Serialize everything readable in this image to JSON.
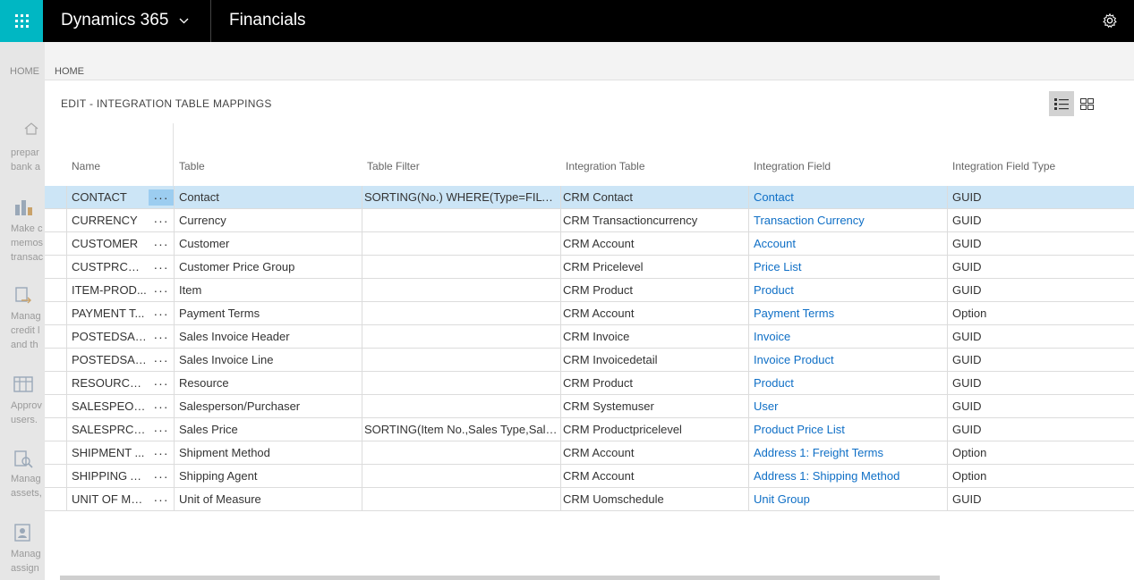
{
  "topbar": {
    "app_name": "Dynamics 365",
    "module_name": "Financials"
  },
  "background": {
    "home_label": "HOME",
    "items": [
      {
        "lines": [
          "prepar",
          "bank a"
        ]
      },
      {
        "lines": [
          "Make c",
          "memos",
          "transac"
        ]
      },
      {
        "lines": [
          "Manag",
          "credit l",
          "and th"
        ]
      },
      {
        "lines": [
          "Approv",
          "users."
        ]
      },
      {
        "lines": [
          "Manag",
          "assets,"
        ]
      },
      {
        "lines": [
          "Manag",
          "assign"
        ]
      }
    ]
  },
  "dialog": {
    "breadcrumb": "HOME",
    "title": "EDIT - INTEGRATION TABLE MAPPINGS",
    "columns": {
      "name": "Name",
      "table": "Table",
      "table_filter": "Table Filter",
      "integration_table": "Integration Table",
      "integration_field": "Integration Field",
      "integration_field_type": "Integration Field Type"
    },
    "rows": [
      {
        "name": "CONTACT",
        "table": "Contact",
        "filter": "SORTING(No.) WHERE(Type=FILTE...",
        "int_table": "CRM Contact",
        "int_field": "Contact",
        "type": "GUID"
      },
      {
        "name": "CURRENCY",
        "table": "Currency",
        "filter": "",
        "int_table": "CRM Transactioncurrency",
        "int_field": "Transaction Currency",
        "type": "GUID"
      },
      {
        "name": "CUSTOMER",
        "table": "Customer",
        "filter": "",
        "int_table": "CRM Account",
        "int_field": "Account",
        "type": "GUID"
      },
      {
        "name": "CUSTPRCGR...",
        "table": "Customer Price Group",
        "filter": "",
        "int_table": "CRM Pricelevel",
        "int_field": "Price List",
        "type": "GUID"
      },
      {
        "name": "ITEM-PROD...",
        "table": "Item",
        "filter": "",
        "int_table": "CRM Product",
        "int_field": "Product",
        "type": "GUID"
      },
      {
        "name": "PAYMENT T...",
        "table": "Payment Terms",
        "filter": "",
        "int_table": "CRM Account",
        "int_field": "Payment Terms",
        "type": "Option"
      },
      {
        "name": "POSTEDSAL...",
        "table": "Sales Invoice Header",
        "filter": "",
        "int_table": "CRM Invoice",
        "int_field": "Invoice",
        "type": "GUID"
      },
      {
        "name": "POSTEDSAL...",
        "table": "Sales Invoice Line",
        "filter": "",
        "int_table": "CRM Invoicedetail",
        "int_field": "Invoice Product",
        "type": "GUID"
      },
      {
        "name": "RESOURCE-...",
        "table": "Resource",
        "filter": "",
        "int_table": "CRM Product",
        "int_field": "Product",
        "type": "GUID"
      },
      {
        "name": "SALESPEOPLE",
        "table": "Salesperson/Purchaser",
        "filter": "",
        "int_table": "CRM Systemuser",
        "int_field": "User",
        "type": "GUID"
      },
      {
        "name": "SALESPRC-P...",
        "table": "Sales Price",
        "filter": "SORTING(Item No.,Sales Type,Sales...",
        "int_table": "CRM Productpricelevel",
        "int_field": "Product Price List",
        "type": "GUID"
      },
      {
        "name": "SHIPMENT ...",
        "table": "Shipment Method",
        "filter": "",
        "int_table": "CRM Account",
        "int_field": "Address 1: Freight Terms",
        "type": "Option"
      },
      {
        "name": "SHIPPING A...",
        "table": "Shipping Agent",
        "filter": "",
        "int_table": "CRM Account",
        "int_field": "Address 1: Shipping Method",
        "type": "Option"
      },
      {
        "name": "UNIT OF ME...",
        "table": "Unit of Measure",
        "filter": "",
        "int_table": "CRM Uomschedule",
        "int_field": "Unit Group",
        "type": "GUID"
      }
    ],
    "selected_row": 0,
    "row_menu_glyph": "···"
  },
  "colors": {
    "waffle": "#00b7c3",
    "selected_row": "#cce5f6",
    "link": "#0f6fc6"
  }
}
